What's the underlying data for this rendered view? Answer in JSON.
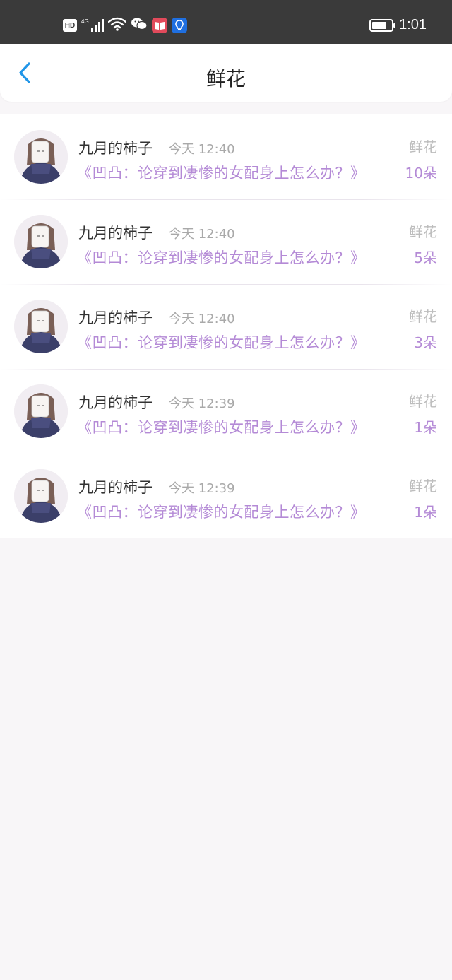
{
  "status_bar": {
    "hd": "HD",
    "network": "4G",
    "time": "1:01",
    "battery_level": 0.7,
    "icons": [
      "hd-icon",
      "signal-icon",
      "wifi-icon",
      "wechat-icon",
      "reader-app-icon",
      "lightbulb-app-icon",
      "battery-icon"
    ]
  },
  "header": {
    "title": "鲜花",
    "back_icon": "chevron-left-icon",
    "accent_color": "#2196e8"
  },
  "colors": {
    "book_title": "#b48ad6",
    "count": "#b48ad6",
    "time": "#a9a9a9"
  },
  "records": [
    {
      "username": "九月的柿子",
      "time": "今天 12:40",
      "book": "《凹凸：论穿到凄惨的女配身上怎么办？》",
      "gift": "鲜花",
      "count": "10朵"
    },
    {
      "username": "九月的柿子",
      "time": "今天 12:40",
      "book": "《凹凸：论穿到凄惨的女配身上怎么办？》",
      "gift": "鲜花",
      "count": "5朵"
    },
    {
      "username": "九月的柿子",
      "time": "今天 12:40",
      "book": "《凹凸：论穿到凄惨的女配身上怎么办？》",
      "gift": "鲜花",
      "count": "3朵"
    },
    {
      "username": "九月的柿子",
      "time": "今天 12:39",
      "book": "《凹凸：论穿到凄惨的女配身上怎么办？》",
      "gift": "鲜花",
      "count": "1朵"
    },
    {
      "username": "九月的柿子",
      "time": "今天 12:39",
      "book": "《凹凸：论穿到凄惨的女配身上怎么办？》",
      "gift": "鲜花",
      "count": "1朵"
    }
  ]
}
